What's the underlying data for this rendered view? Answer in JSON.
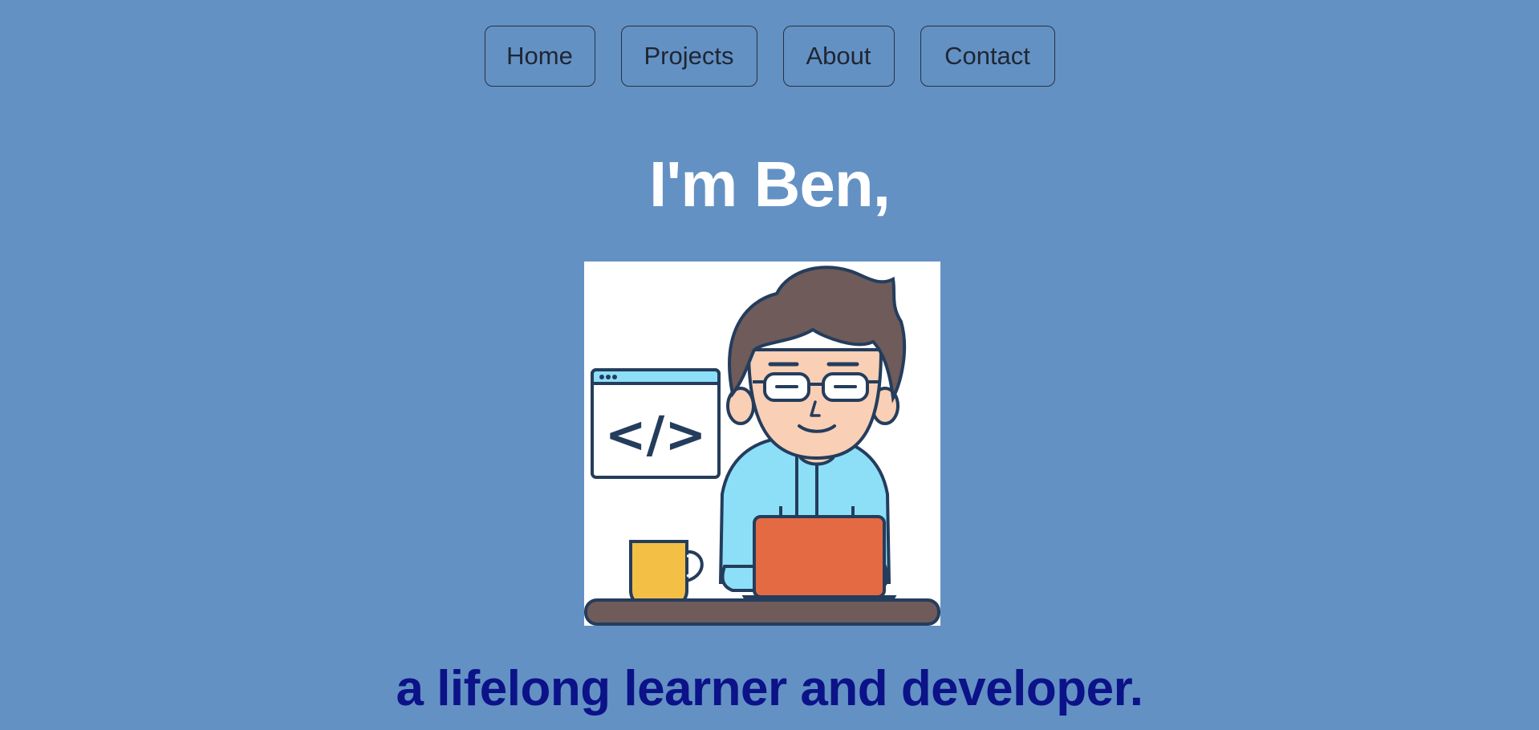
{
  "nav": {
    "items": [
      {
        "label": "Home"
      },
      {
        "label": "Projects"
      },
      {
        "label": "About"
      },
      {
        "label": "Contact"
      }
    ]
  },
  "hero": {
    "title": "I'm Ben,",
    "illustration_icon": "developer-avatar-illustration",
    "code_symbol": "</>",
    "tagline": "a lifelong learner and developer."
  },
  "colors": {
    "background": "#6391c4",
    "title": "#ffffff",
    "tagline": "#0c1288",
    "hair": "#6e5b5a",
    "skin": "#f9cfb5",
    "shirt": "#8ddff8",
    "laptop": "#e46a44",
    "mug": "#f4bf45",
    "desk": "#6e5b5a",
    "outline": "#243d5c"
  }
}
